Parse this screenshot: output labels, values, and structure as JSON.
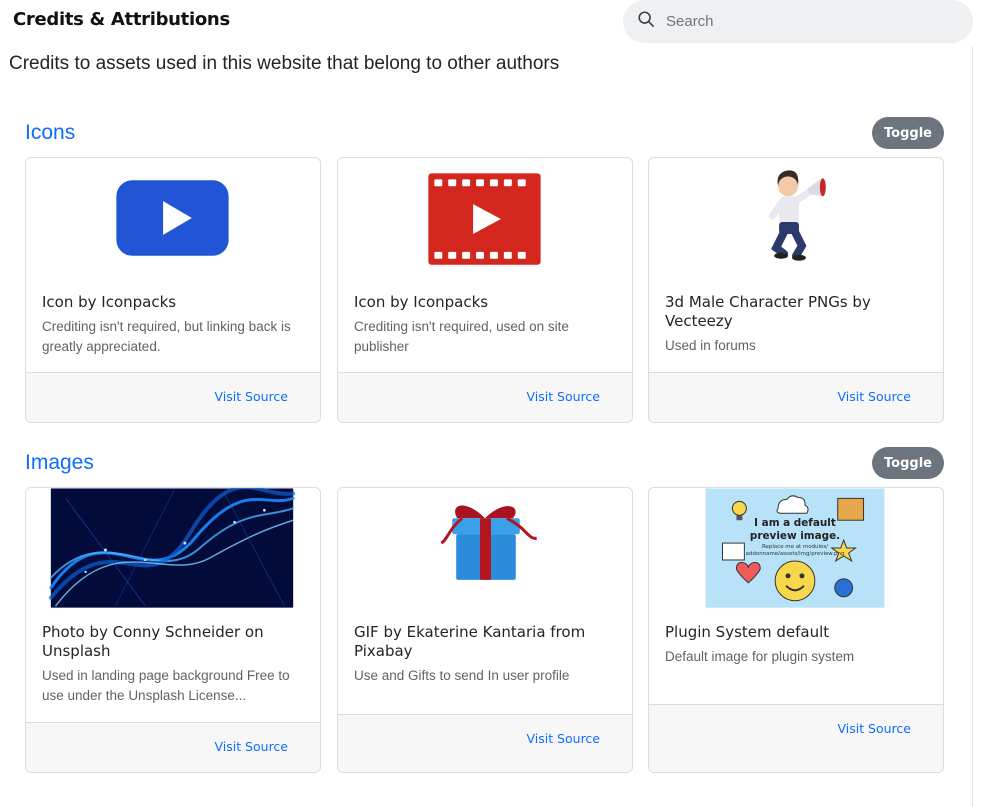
{
  "header": {
    "title": "Credits & Attributions",
    "search_placeholder": "Search"
  },
  "subtitle": "Credits to assets used in this website that belong to other authors",
  "sections": [
    {
      "title": "Icons",
      "toggle_label": "Toggle",
      "cards": [
        {
          "title": "Icon by Iconpacks",
          "text": "Crediting isn't required, but linking back is greatly appreciated.",
          "link": "Visit Source",
          "image": "blue-play-button-icon"
        },
        {
          "title": "Icon by Iconpacks",
          "text": "Crediting isn't required, used on site publisher",
          "link": "Visit Source",
          "image": "red-film-play-icon"
        },
        {
          "title": "3d Male Character PNGs by Vecteezy",
          "text": "Used in forums",
          "link": "Visit Source",
          "image": "3d-man-megaphone-image"
        }
      ]
    },
    {
      "title": "Images",
      "toggle_label": "Toggle",
      "cards": [
        {
          "title": "Photo by Conny Schneider on Unsplash",
          "text": "Used in landing page background Free to use under the Unsplash License...",
          "link": "Visit Source",
          "image": "blue-network-wave-photo"
        },
        {
          "title": "GIF by Ekaterine Kantaria from Pixabay",
          "text": "Use and Gifts to send In user profile",
          "link": "Visit Source",
          "image": "gift-box-image"
        },
        {
          "title": "Plugin System default",
          "text": "Default image for plugin system",
          "link": "Visit Source",
          "image": "default-preview-image"
        }
      ]
    }
  ],
  "preview_image": {
    "line1": "I am a default",
    "line2": "preview image.",
    "line3": "Replace me at modules/",
    "line4": "addonname/assets/img/preview.png"
  },
  "colors": {
    "accent": "#0d6efd",
    "toggle_bg": "#6c757d",
    "youtube_blue": "#2155d6",
    "film_red": "#d3261d",
    "network_bg": "#020b3a",
    "preview_bg": "#b8e2f8"
  }
}
